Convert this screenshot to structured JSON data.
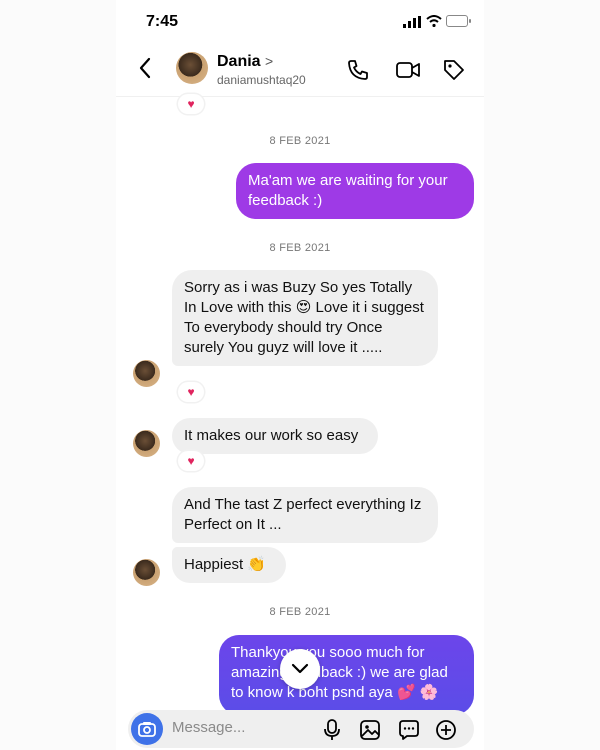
{
  "status": {
    "time": "7:45"
  },
  "header": {
    "name": "Dania",
    "chevron": ">",
    "username": "daniamushtaq20"
  },
  "messages": {
    "date1": "8 FEB 2021",
    "out1": "Ma'am we are waiting for your feedback :)",
    "date2": "8 FEB 2021",
    "in1_a": "Sorry as i was Buzy So yes Totally In Love with this",
    "in1_emoji": "😍",
    "in1_b": "Love it   i suggest To everybody should try Once surely You guyz will love it .....",
    "in2": "It makes our work so easy",
    "in3": "And The tast Z perfect everything Iz Perfect on It ...",
    "in4": "Happiest",
    "in4_emoji": "👏",
    "date3": "8 FEB 2021",
    "out2": "Thankyou you sooo much for amazing feedback :) we are glad to know k boht psnd aya",
    "out2_emoji": "💕 🌸",
    "reaction": "♥"
  },
  "composer": {
    "placeholder": "Message..."
  },
  "colors": {
    "outgoing_top": "#a33be6",
    "outgoing_bottom": "#6c45ea",
    "camera": "#3f72e8",
    "incoming": "#efefef"
  }
}
